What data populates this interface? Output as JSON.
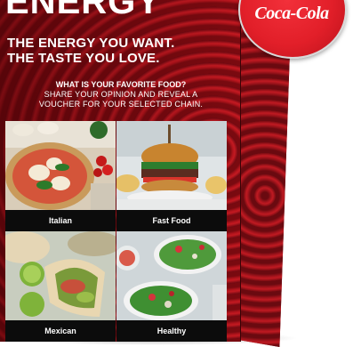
{
  "brand": {
    "logo_text": "Coca-Cola",
    "accent": "#e21f29"
  },
  "screen": {
    "hero_word": "ENERGY",
    "headline": [
      "THE ENERGY YOU WANT.",
      "THE TASTE YOU LOVE."
    ],
    "question": "WHAT IS YOUR FAVORITE FOOD?",
    "prompt": [
      "SHARE YOUR OPINION AND REVEAL A",
      "VOUCHER FOR YOUR SELECTED CHAIN."
    ],
    "options": [
      {
        "label": "Italian"
      },
      {
        "label": "Fast Food"
      },
      {
        "label": "Mexican"
      },
      {
        "label": "Healthy"
      }
    ]
  }
}
